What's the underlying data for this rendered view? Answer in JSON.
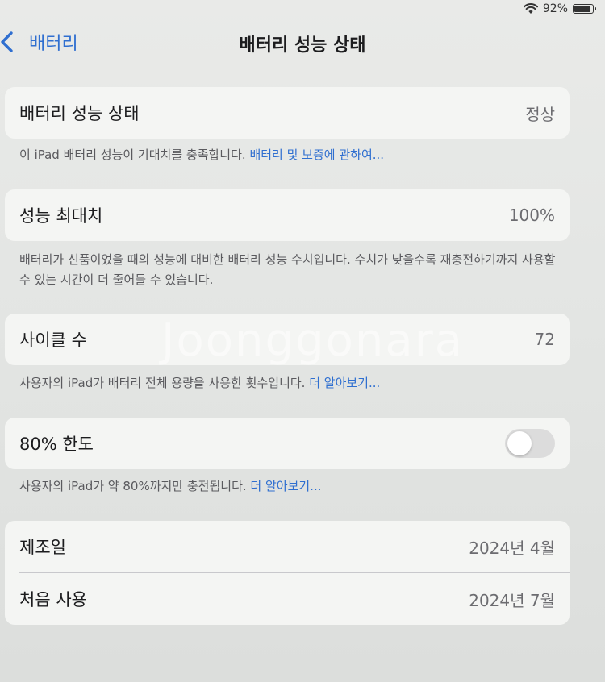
{
  "status": {
    "battery_percent": "92%",
    "battery_level": 0.92
  },
  "nav": {
    "back_label": "배터리",
    "title": "배터리 성능 상태"
  },
  "health": {
    "label": "배터리 성능 상태",
    "value": "정상",
    "footer_text": "이 iPad 배터리 성능이 기대치를 충족합니다. ",
    "footer_link": "배터리 및 보증에 관하여..."
  },
  "max_capacity": {
    "label": "성능 최대치",
    "value": "100%",
    "footer_text": "배터리가 신품이었을 때의 성능에 대비한 배터리 성능 수치입니다. 수치가 낮을수록 재충전하기까지 사용할 수 있는 시간이 더 줄어들 수 있습니다."
  },
  "cycle_count": {
    "label": "사이클 수",
    "value": "72",
    "footer_text": "사용자의 iPad가 배터리 전체 용량을 사용한 횟수입니다. ",
    "footer_link": "더 알아보기..."
  },
  "limit": {
    "label": "80% 한도",
    "enabled": false,
    "footer_text": "사용자의 iPad가 약 80%까지만 충전됩니다. ",
    "footer_link": "더 알아보기..."
  },
  "dates": {
    "manufacture_label": "제조일",
    "manufacture_value": "2024년 4월",
    "first_use_label": "처음 사용",
    "first_use_value": "2024년 7월"
  },
  "watermark": "Joonggonara",
  "colors": {
    "link": "#2f6fd0",
    "toggle_off": "#dcdcdc"
  }
}
